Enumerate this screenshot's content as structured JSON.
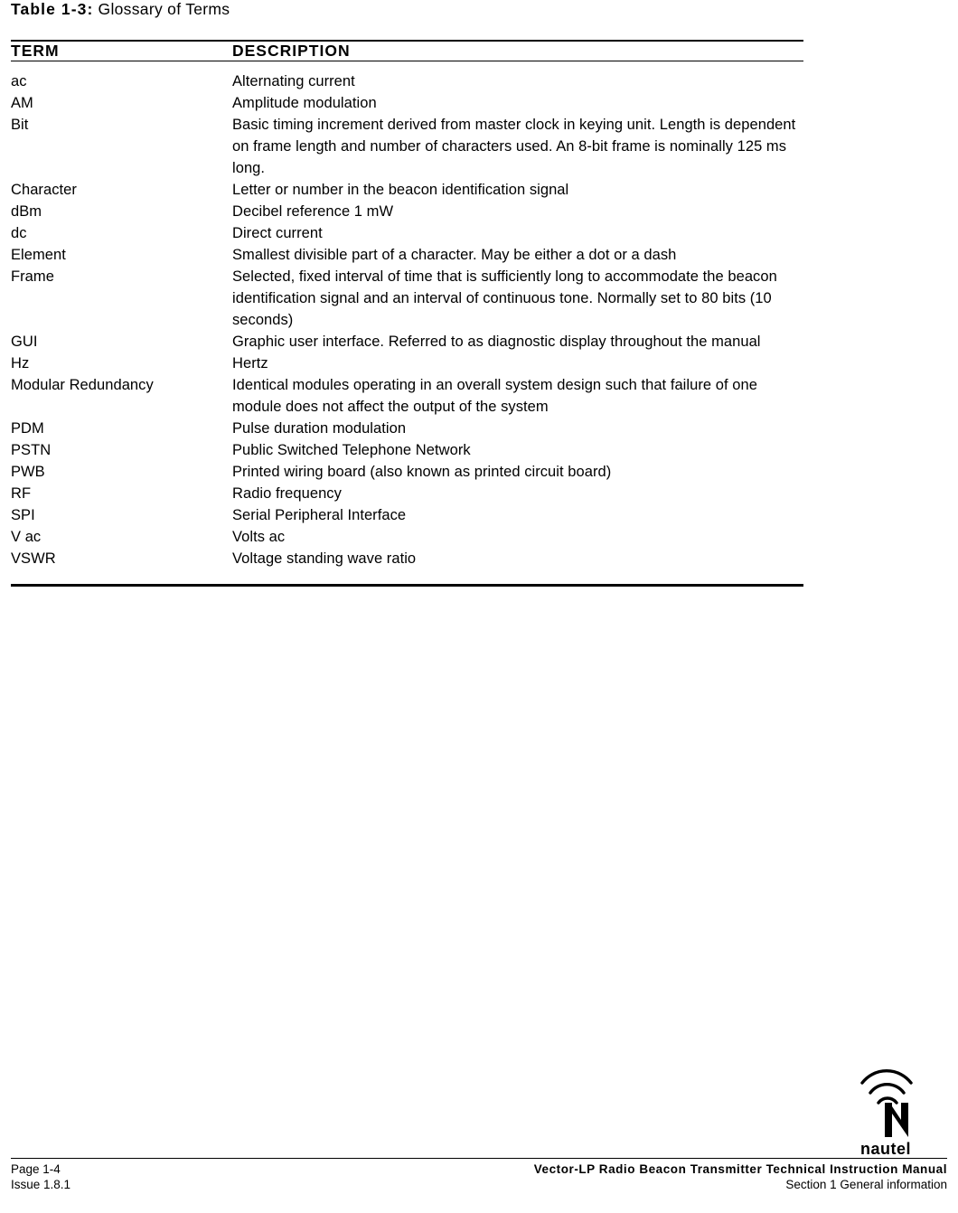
{
  "caption": {
    "label": "Table 1-3:",
    "text": " Glossary of Terms"
  },
  "table": {
    "headers": {
      "term": "TERM",
      "description": "DESCRIPTION"
    },
    "rows": [
      {
        "term": "ac",
        "description": "Alternating current"
      },
      {
        "term": "AM",
        "description": "Amplitude modulation"
      },
      {
        "term": "Bit",
        "description": "Basic timing increment derived from master clock in keying unit. Length is dependent on frame length and number of characters used. An 8-bit frame is nominally 125 ms long."
      },
      {
        "term": "Character",
        "description": "Letter or number in the beacon identification signal"
      },
      {
        "term": "dBm",
        "description": "Decibel reference 1 mW"
      },
      {
        "term": "dc",
        "description": "Direct current"
      },
      {
        "term": "Element",
        "description": "Smallest divisible part of a character. May be either a dot or a dash"
      },
      {
        "term": "Frame",
        "description": "Selected, fixed interval of time that is sufficiently long to accommodate the beacon identification signal and an interval of continuous tone. Normally set to 80 bits (10 seconds)"
      },
      {
        "term": "GUI",
        "description": "Graphic user interface. Referred to as diagnostic display throughout the manual"
      },
      {
        "term": "Hz",
        "description": "Hertz"
      },
      {
        "term": "Modular Redundancy",
        "description": "Identical modules operating in an overall system design such that failure of one module does not affect the output of the system"
      },
      {
        "term": "PDM",
        "description": "Pulse duration modulation"
      },
      {
        "term": "PSTN",
        "description": "Public Switched Telephone Network"
      },
      {
        "term": "PWB",
        "description": "Printed wiring board (also known as printed circuit board)"
      },
      {
        "term": "RF",
        "description": "Radio frequency"
      },
      {
        "term": "SPI",
        "description": "Serial Peripheral Interface"
      },
      {
        "term": "V ac",
        "description": "Volts ac"
      },
      {
        "term": "VSWR",
        "description": "Voltage standing wave ratio"
      }
    ]
  },
  "logo": {
    "wordmark": "nautel"
  },
  "footer": {
    "page": "Page 1-4",
    "issue": "Issue 1.8.1",
    "title": "Vector-LP Radio Beacon Transmitter Technical Instruction Manual",
    "section": "Section 1 General information"
  }
}
